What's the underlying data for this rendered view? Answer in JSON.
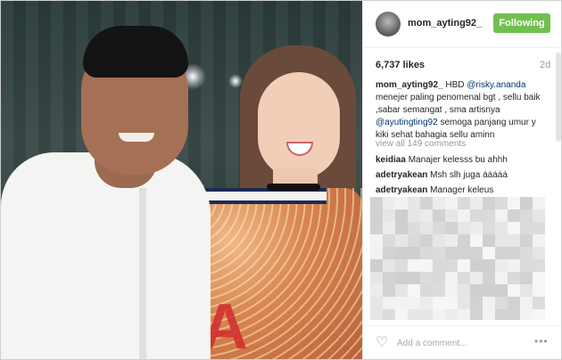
{
  "post": {
    "username": "mom_ayting92_",
    "follow_label": "Following",
    "likes": "6,737 likes",
    "time": "2d",
    "caption": {
      "username": "mom_ayting92_",
      "text_before_mention1": "HBD",
      "mention1": "@risky.ananda",
      "text_middle": "menejer paling penomenal bgt , sellu baik ,sabar semangat , sma artisnya",
      "mention2": "@ayutingting92",
      "text_after": "semoga panjang umur y kiki sehat bahagia sellu aminn"
    },
    "view_all": "view all 149 comments",
    "comments": [
      {
        "user": "keidiaa",
        "text": "Manajer kelesss bu ahhh"
      },
      {
        "user": "adetryakean",
        "text": "Msh slh juga ẚẚẚẚẚ"
      },
      {
        "user": "adetryakean",
        "text": "Manager keleus"
      }
    ],
    "add_comment_placeholder": "Add a comment...",
    "more_icon": "•••"
  },
  "photo": {
    "dress_letter": "A"
  },
  "icons": {
    "heart": "heart-icon",
    "avatar": "avatar",
    "more": "more-options-icon"
  },
  "colors": {
    "follow_button": "#70c050",
    "mention": "#003569"
  }
}
